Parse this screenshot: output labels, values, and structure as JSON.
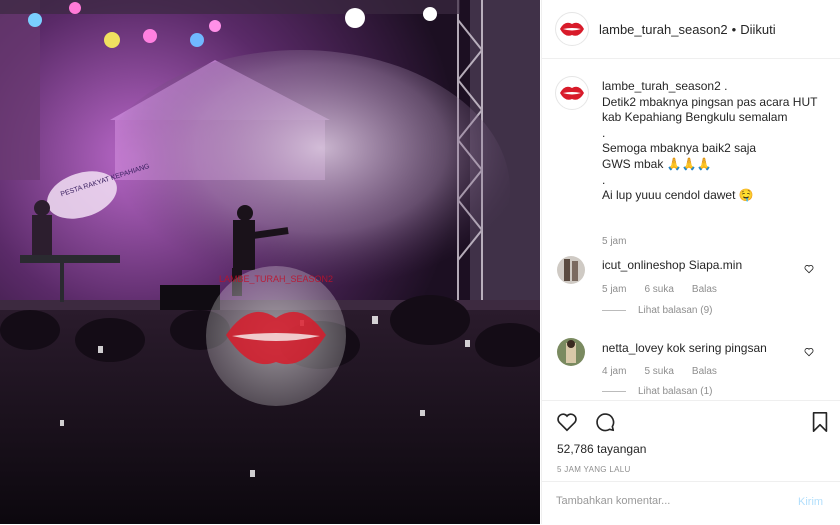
{
  "post": {
    "username": "lambe_turah_season2",
    "separator": "•",
    "follow_status": "Diikuti",
    "media_watermark": "LAMBE_TURAH_SEASON2",
    "stage_banner": "PESTA RAKYAT KEPAHIANG"
  },
  "caption": {
    "username": "lambe_turah_season2",
    "lines": [
      "Detik2 mbaknya pingsan pas acara HUT kab Kepahiang Bengkulu semalam",
      ".",
      "Semoga mbaknya baik2 saja",
      "GWS mbak 🙏🙏🙏",
      ".",
      "Ai lup yuuu cendol dawet 🤤"
    ],
    "time": "5 jam"
  },
  "comments": [
    {
      "username": "icut_onlineshop",
      "text": "Siapa.min",
      "time": "5 jam",
      "likes": "6 suka",
      "reply_label": "Balas",
      "view_replies": "Lihat balasan (9)"
    },
    {
      "username": "netta_lovey",
      "text": "kok sering pingsan",
      "time": "4 jam",
      "likes": "5 suka",
      "reply_label": "Balas",
      "view_replies": "Lihat balasan (1)"
    }
  ],
  "stats": {
    "views": "52,786 tayangan",
    "ago": "5 JAM YANG LALU"
  },
  "composer": {
    "placeholder": "Tambahkan komentar...",
    "post_label": "Kirim"
  },
  "icons": [
    "heart-icon",
    "comment-icon",
    "bookmark-icon",
    "heart-small-icon"
  ],
  "colors": {
    "text": "#262626",
    "secondary": "#8e8e8e",
    "border": "#efefef",
    "post_button": "#b2dffc",
    "stage_light": "#e05ad8"
  }
}
